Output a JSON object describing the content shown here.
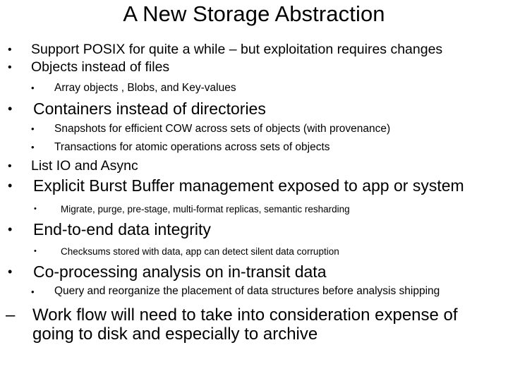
{
  "slide": {
    "title": "A New Storage Abstraction",
    "background_color": "#ffffff",
    "text_color": "#000000",
    "bullet_glyph": "•",
    "dash_glyph": "–",
    "items": [
      {
        "level": 1,
        "marker": "•",
        "text": "Support POSIX for quite a while – but exploitation requires changes"
      },
      {
        "level": 1,
        "marker": "•",
        "text": "Objects instead of files"
      },
      {
        "level": 2,
        "marker": "•",
        "text": "Array objects , Blobs, and Key-values"
      },
      {
        "level": 1,
        "marker": "•",
        "text": "Containers instead of directories"
      },
      {
        "level": 2,
        "marker": "•",
        "text": "Snapshots for efficient COW across sets of objects (with provenance)"
      },
      {
        "level": 2,
        "marker": "•",
        "text": "Transactions for atomic operations across sets of objects"
      },
      {
        "level": 1,
        "marker": "•",
        "text": "List IO and Async"
      },
      {
        "level": 1,
        "marker": "•",
        "text": "Explicit Burst Buffer management exposed to app or system"
      },
      {
        "level": 2,
        "marker": "•",
        "text": "Migrate, purge, pre-stage, multi-format replicas, semantic resharding"
      },
      {
        "level": 1,
        "marker": "•",
        "text": "End-to-end data integrity"
      },
      {
        "level": 2,
        "marker": "•",
        "text": "Checksums stored with data, app can detect silent data corruption"
      },
      {
        "level": 1,
        "marker": "•",
        "text": "Co-processing analysis on in-transit data"
      },
      {
        "level": 2,
        "marker": "•",
        "text": "Query and reorganize the placement of data structures before analysis shipping"
      },
      {
        "level": 1,
        "marker": "–",
        "text": "Work flow will need to take into consideration expense of going to disk and especially to archive"
      }
    ]
  }
}
